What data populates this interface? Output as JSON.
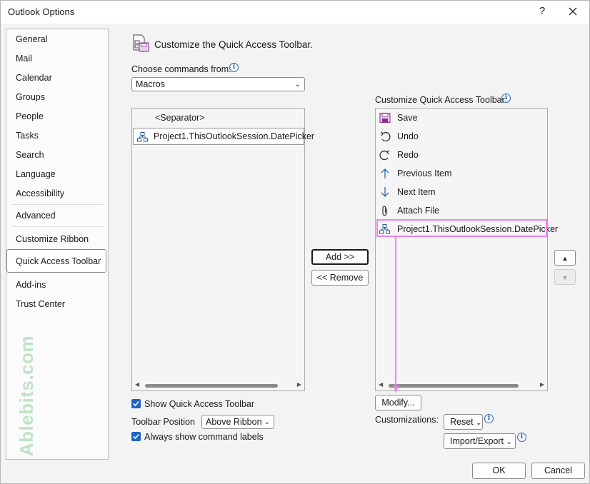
{
  "window": {
    "title": "Outlook Options",
    "help_label": "?"
  },
  "nav": {
    "items": [
      "General",
      "Mail",
      "Calendar",
      "Groups",
      "People",
      "Tasks",
      "Search",
      "Language",
      "Accessibility",
      "Advanced",
      "Customize Ribbon",
      "Quick Access Toolbar",
      "Add-ins",
      "Trust Center"
    ],
    "selected": "Quick Access Toolbar"
  },
  "watermark": "Ablebits.com",
  "main": {
    "title": "Customize the Quick Access Toolbar.",
    "choose_label": "Choose commands from:",
    "choose_value": "Macros",
    "customize_label": "Customize Quick Access Toolbar:",
    "left_list": [
      "<Separator>",
      "Project1.ThisOutlookSession.DatePicker"
    ],
    "right_list": [
      {
        "label": "Save",
        "icon": "save-icon"
      },
      {
        "label": "Undo",
        "icon": "undo-icon"
      },
      {
        "label": "Redo",
        "icon": "redo-icon"
      },
      {
        "label": "Previous Item",
        "icon": "arrow-up-icon"
      },
      {
        "label": "Next Item",
        "icon": "arrow-down-icon"
      },
      {
        "label": "Attach File",
        "icon": "paperclip-icon"
      },
      {
        "label": "Project1.ThisOutlookSession.DatePicker",
        "icon": "macro-icon"
      }
    ],
    "add_button": "Add >>",
    "remove_button": "<< Remove",
    "modify_button": "Modify...",
    "show_qat_label": "Show Quick Access Toolbar",
    "toolbar_position_label": "Toolbar Position",
    "toolbar_position_value": "Above Ribbon",
    "always_show_labels": "Always show command labels",
    "customizations_label": "Customizations:",
    "reset_button": "Reset",
    "import_export_button": "Import/Export"
  },
  "footer": {
    "ok": "OK",
    "cancel": "Cancel"
  },
  "colors": {
    "accent": "#1e64c8",
    "highlight": "#ee82ee",
    "watermark": "#bfe3c9"
  }
}
